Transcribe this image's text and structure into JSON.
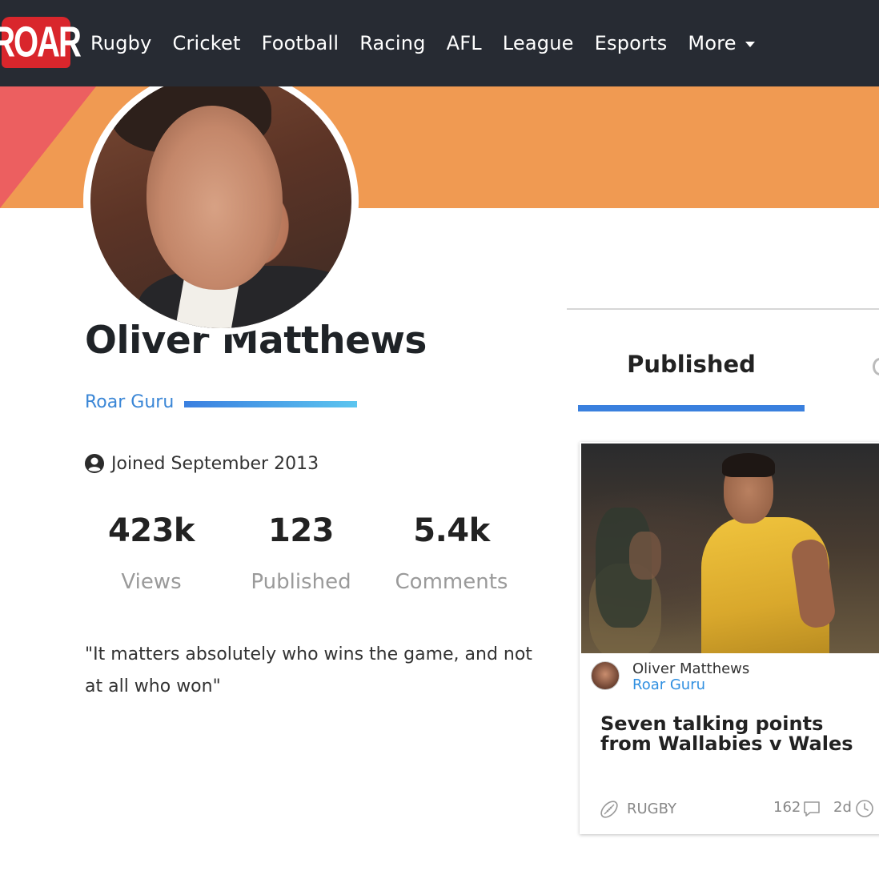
{
  "nav": {
    "logo": "ROAR",
    "links": [
      "Rugby",
      "Cricket",
      "Football",
      "Racing",
      "AFL",
      "League",
      "Esports"
    ],
    "more_label": "More"
  },
  "profile": {
    "name": "Oliver Matthews",
    "role": "Roar Guru",
    "joined": "Joined September 2013",
    "stats": [
      {
        "value": "423k",
        "label": "Views"
      },
      {
        "value": "123",
        "label": "Published"
      },
      {
        "value": "5.4k",
        "label": "Comments"
      }
    ],
    "quote": "\"It matters absolutely who wins the game, and not at all who won\""
  },
  "tabs": {
    "active": "Published"
  },
  "article_card": {
    "author_name": "Oliver Matthews",
    "author_role": "Roar Guru",
    "title": "Seven talking points from Wallabies v Wales",
    "category": "RUGBY",
    "comment_count": "162",
    "time_ago": "2d"
  },
  "colors": {
    "nav_bg": "#272b33",
    "logo_red": "#d9262c",
    "banner_orange": "#f09a52",
    "banner_red": "#ec5f60",
    "accent_blue": "#3a80de"
  }
}
